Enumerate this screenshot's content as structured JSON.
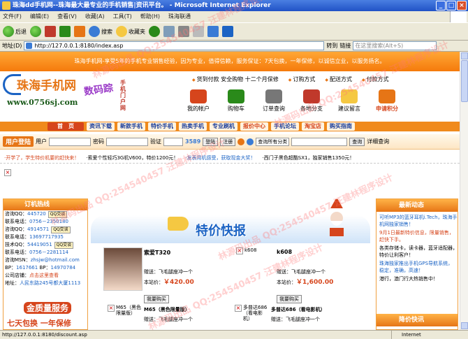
{
  "window": {
    "title": "珠海dd手机网--珠海最大最专业的手机销售|资讯平台。 - Microsoft Internet Explorer",
    "min": "_",
    "max": "□",
    "close": "×"
  },
  "menu": [
    "文件(F)",
    "编辑(E)",
    "查看(V)",
    "收藏(A)",
    "工具(T)",
    "帮助(H)",
    "珠海联通"
  ],
  "toolbar": {
    "back": "后退",
    "search": "搜索",
    "favorites": "收藏夹"
  },
  "address": {
    "label": "地址(D)",
    "url": "http://127.0.0.1:8180/index.asp",
    "go": "转到",
    "links": "链接",
    "search_placeholder": "在这里搜索(Alt+S)"
  },
  "status": {
    "url": "http://127.0.0.1:8180/discount.asp",
    "zone": "Internet"
  },
  "page": {
    "topbar": "珠海手机网-享受5年的手机专业销售经验，因为专业，值得信赖，服务保证：7天包换，一年保修，以诚信立业，以服务扬名。",
    "logo_brand": "珠海手机网",
    "logo_url": "www.0756sj.com",
    "slogan": "数码踪",
    "vertical": "手机门户网",
    "toplinks": [
      "货到付款 安全购物 十二个月保修",
      "订购方式",
      "配送方式",
      "付款方式"
    ],
    "iconnav": [
      "我的帐户",
      "购物车",
      "订单查询",
      "各地分支",
      "建议留言",
      "申请积分"
    ],
    "nav": [
      "首　页",
      "资讯下载",
      "新款手机",
      "特价手机",
      "热卖手机",
      "专业刷机",
      "报价中心",
      "手机论坛",
      "淘宝店",
      "购买指南"
    ],
    "login": {
      "title": "用户登陆",
      "user": "用户",
      "pass": "密码",
      "verify": "验证",
      "code": "3589",
      "login_btn": "登陆",
      "register_btn": "注册",
      "search_select": "查询所有分类",
      "search_btn": "查询",
      "detail": "详细查询"
    },
    "ticker": [
      "·开学了，学生特价机要的赶快来！",
      "·索爱个性轻巧3G机V600，特价1200元！",
      "·发表用机感受，获取现金大奖！",
      "·西门子黑色超酷SX1，独家销售1350元！"
    ],
    "hotline": {
      "title": "订机热线",
      "rows": [
        {
          "k": "咨询QQ：",
          "v": "445720",
          "qq": "QQ交谈"
        },
        {
          "k": "联系电话：",
          "v": "0756－2350180"
        },
        {
          "k": "咨询QQ：",
          "v": "4914571",
          "qq": "QQ交谈"
        },
        {
          "k": "联系电话：",
          "v": "13697717935"
        },
        {
          "k": "技术QQ：",
          "v": "54419051",
          "qq": "QQ交谈"
        },
        {
          "k": "联系电话：",
          "v": "0756－2281114"
        },
        {
          "k": "咨询MSN：",
          "v": "zhsjw@hotmail.com"
        },
        {
          "k": "BP：",
          "v": "1617661",
          "k2": "BP：",
          "v2": "14970784"
        },
        {
          "k": "公司店铺：",
          "v": "点击这里查看"
        },
        {
          "k": "地址：",
          "v": "人民东路245号都大厦1113"
        }
      ],
      "promo1": "金质量服务",
      "promo2": "七天包换 一年保修"
    },
    "banner_title": "特价快报",
    "products": [
      {
        "name": "索爱T320",
        "gift": "赠送：飞毛腿座冲一个",
        "price_label": "本站价：",
        "price": "￥420.00",
        "buy": "我要购买"
      },
      {
        "name": "k608",
        "alt": "k608",
        "gift": "赠送：飞毛腿座冲一个",
        "price_label": "本站价：",
        "price": "￥1,600.00",
        "buy": "我要购买"
      }
    ],
    "products2": [
      {
        "name": "M65（黑色限量版）",
        "alt": "M65（黑色限量版）",
        "gift": "赠送：飞毛腿座冲一个"
      },
      {
        "name": "多普达686（看电影机）",
        "alt": "多普达686（看电影机）",
        "gift": "赠送：飞毛腿座冲一个"
      }
    ],
    "news": {
      "title": "最新动态",
      "items": [
        "可听MP3的蓝牙耳机i.Tech，珠海手机网独家销售！",
        "9月1日最新特价信息，限量销售，赶快下手。",
        "各类存储卡，读卡器，蓝牙适配器，特价让利客户！",
        "珠海独家推出手机GPS导航系统，稳定，准确，高速！",
        "港行，澳门行大热销售中！"
      ],
      "title2": "降价快讯"
    }
  },
  "watermark": "林源码出品 QQ:254540457 汪建林程序设计"
}
